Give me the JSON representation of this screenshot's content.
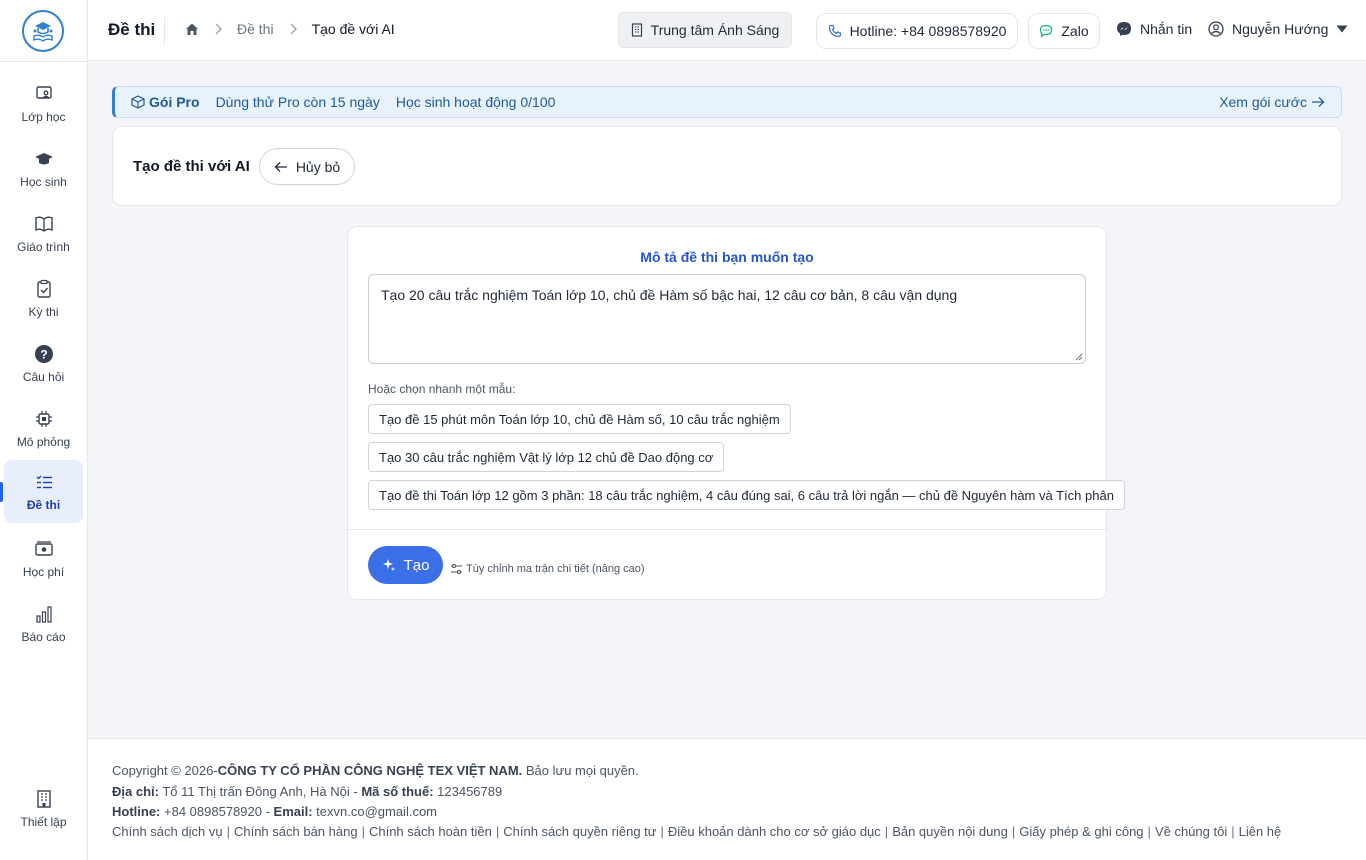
{
  "sidebar": {
    "items": [
      {
        "label": "Lớp học",
        "icon": "classroom-icon"
      },
      {
        "label": "Học sinh",
        "icon": "graduation-cap-icon"
      },
      {
        "label": "Giáo trình",
        "icon": "book-icon"
      },
      {
        "label": "Kỳ thi",
        "icon": "clipboard-check-icon"
      },
      {
        "label": "Câu hỏi",
        "icon": "question-circle-icon"
      },
      {
        "label": "Mô phỏng",
        "icon": "chip-icon"
      },
      {
        "label": "Đề thi",
        "icon": "list-icon",
        "active": true
      },
      {
        "label": "Học phí",
        "icon": "money-icon"
      },
      {
        "label": "Báo cáo",
        "icon": "bar-chart-icon"
      }
    ],
    "settings_label": "Thiết lập"
  },
  "header": {
    "title": "Đề thi",
    "breadcrumb": [
      "Đề thi",
      "Tạo đề với AI"
    ],
    "center_name": "Trung tâm Ánh Sáng",
    "hotline": "Hotline: +84 0898578920",
    "zalo": "Zalo",
    "message": "Nhắn tin",
    "user_name": "Nguyễn Hướng"
  },
  "banner": {
    "plan": "Gói Pro",
    "trial": "Dùng thử Pro còn 15 ngày",
    "students": "Học sinh hoạt động 0/100",
    "link": "Xem gói cước"
  },
  "title_card": {
    "title": "Tạo đề thi với AI",
    "cancel_label": "Hủy bỏ"
  },
  "form": {
    "heading": "Mô tả đề thi bạn muốn tạo",
    "prompt_value": "Tạo 20 câu trắc nghiệm Toán lớp 10, chủ đề Hàm số bậc hai, 12 câu cơ bản, 8 câu vận dụng",
    "quick_label": "Hoặc chọn nhanh một mẫu:",
    "templates": [
      "Tạo đề 15 phút môn Toán lớp 10, chủ đề Hàm số, 10 câu trắc nghiệm",
      "Tạo 30 câu trắc nghiệm Vật lý lớp 12 chủ đề Dao động cơ",
      "Tạo đề thi Toán lớp 12 gồm 3 phần: 18 câu trắc nghiệm, 4 câu đúng sai, 6 câu trả lời ngắn — chủ đề Nguyên hàm và Tích phân"
    ],
    "create_label": "Tạo",
    "advanced_label": "Tùy chỉnh ma trận chi tiết (nâng cao)"
  },
  "footer": {
    "copyright_prefix": "Copyright © 2026-",
    "company": "CÔNG TY CỔ PHẦN CÔNG NGHỆ TEX VIỆT NAM.",
    "rights": " Bảo lưu mọi quyền.",
    "address_label": "Địa chỉ:",
    "address": " Tổ 11 Thị trấn Đông Anh, Hà Nội - ",
    "tax_label": "Mã số thuế:",
    "tax": " 123456789",
    "hotline_label": "Hotline:",
    "hotline": " +84 0898578920 - ",
    "email_label": "Email:",
    "email": " texvn.co@gmail.com",
    "links": [
      "Chính sách dịch vụ",
      "Chính sách bán hàng",
      "Chính sách hoàn tiền",
      "Chính sách quyền riêng tư",
      "Điều khoản dành cho cơ sở giáo dục",
      "Bản quyền nội dung",
      "Giấy phép & ghi công",
      "Về chúng tôi",
      "Liên hệ"
    ]
  },
  "colors": {
    "accent": "#3b6fe8",
    "banner_bg": "#e8f2fc",
    "active_nav_bg": "#e8eefc"
  }
}
